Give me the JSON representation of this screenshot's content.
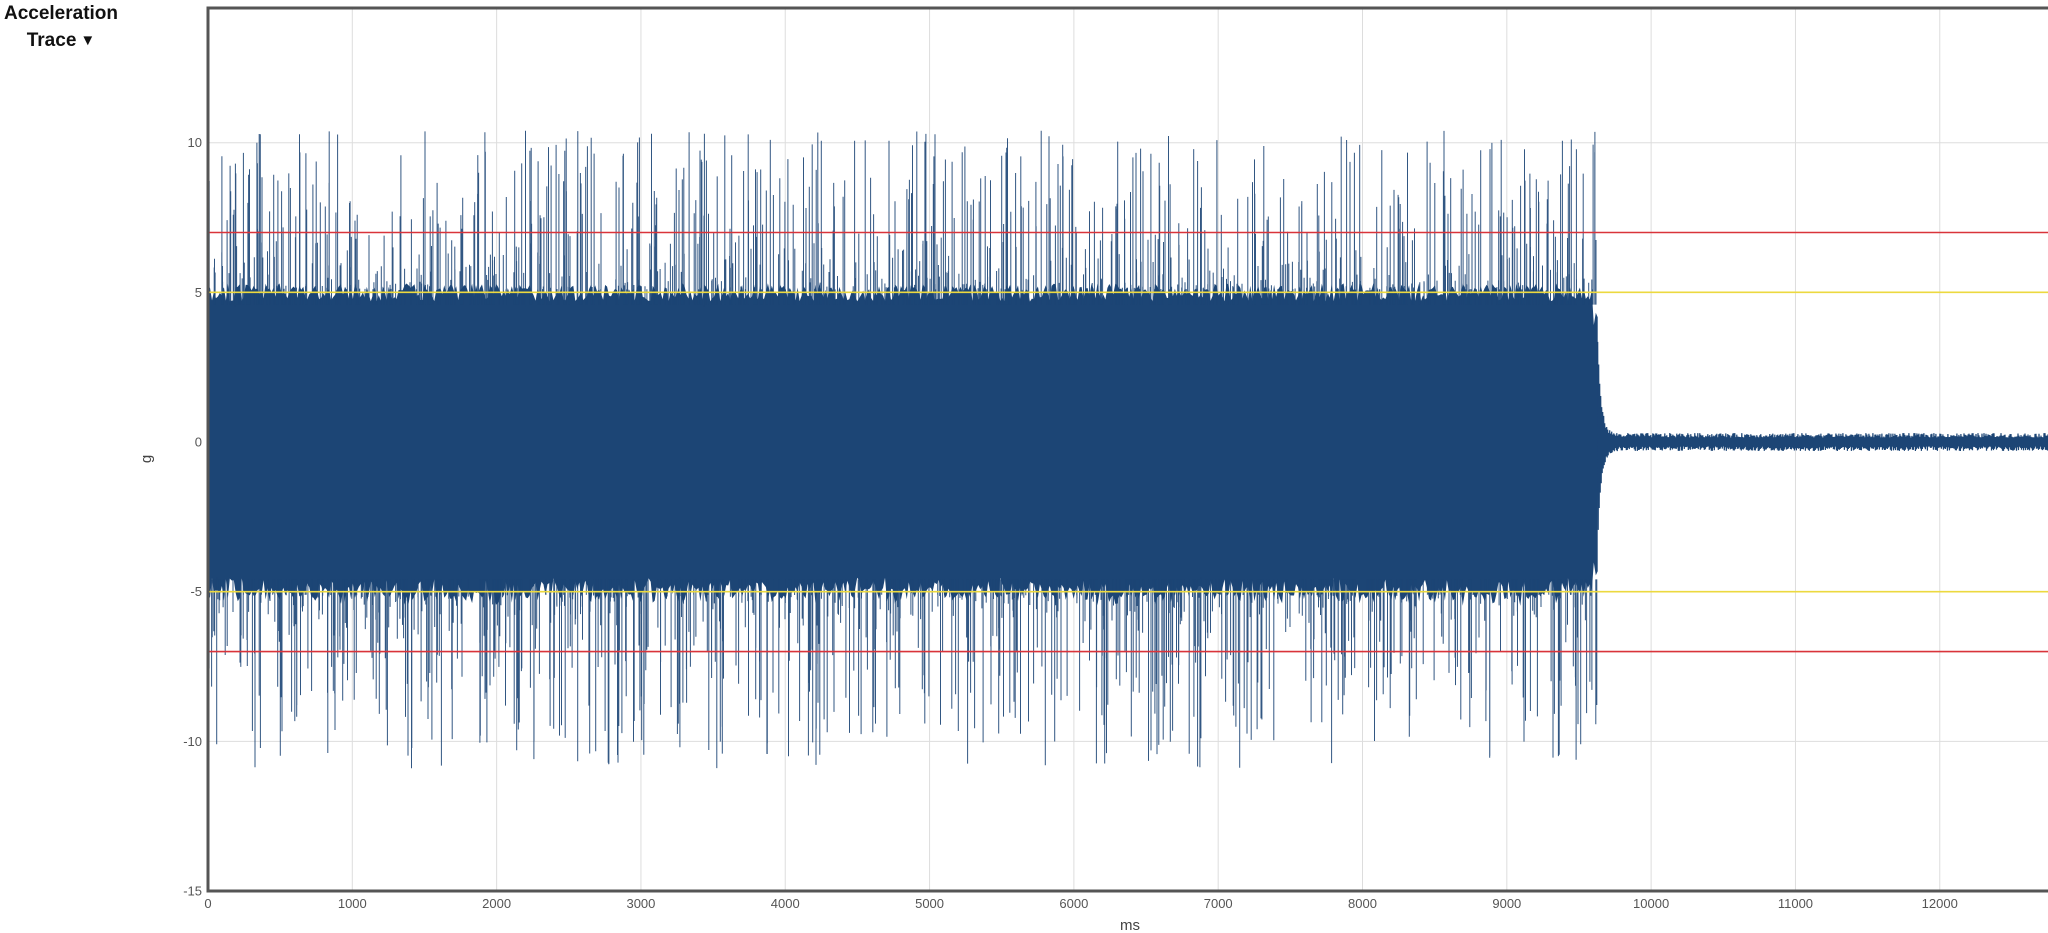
{
  "chart_data": {
    "type": "line",
    "title_line1": "Acceleration",
    "title_line2": "Trace",
    "title_caret": "▼",
    "xlabel": "ms",
    "ylabel": "g",
    "xlim": [
      0,
      12750
    ],
    "ylim": [
      -15,
      14.5
    ],
    "x_ticks": [
      0,
      1000,
      2000,
      3000,
      4000,
      5000,
      6000,
      7000,
      8000,
      9000,
      10000,
      11000,
      12000
    ],
    "y_ticks": [
      10,
      5,
      0,
      -5,
      -10,
      -15
    ],
    "grid": true,
    "series": [
      {
        "color": "#1c4575",
        "active_range_ms": [
          0,
          9630
        ],
        "active_amplitude_g": 5.1,
        "peak_max_g": 10.4,
        "peak_min_g": -10.9,
        "idle_amplitude_g": 0.3
      }
    ],
    "threshold_lines": [
      {
        "value": 7,
        "color": "#d9343a"
      },
      {
        "value": 5,
        "color": "#ecd93f"
      },
      {
        "value": -5,
        "color": "#ecd93f"
      },
      {
        "value": -7,
        "color": "#d9343a"
      }
    ]
  },
  "colors": {
    "grid": "#dddddd",
    "frame": "#555555",
    "trace": "#1c4575"
  }
}
